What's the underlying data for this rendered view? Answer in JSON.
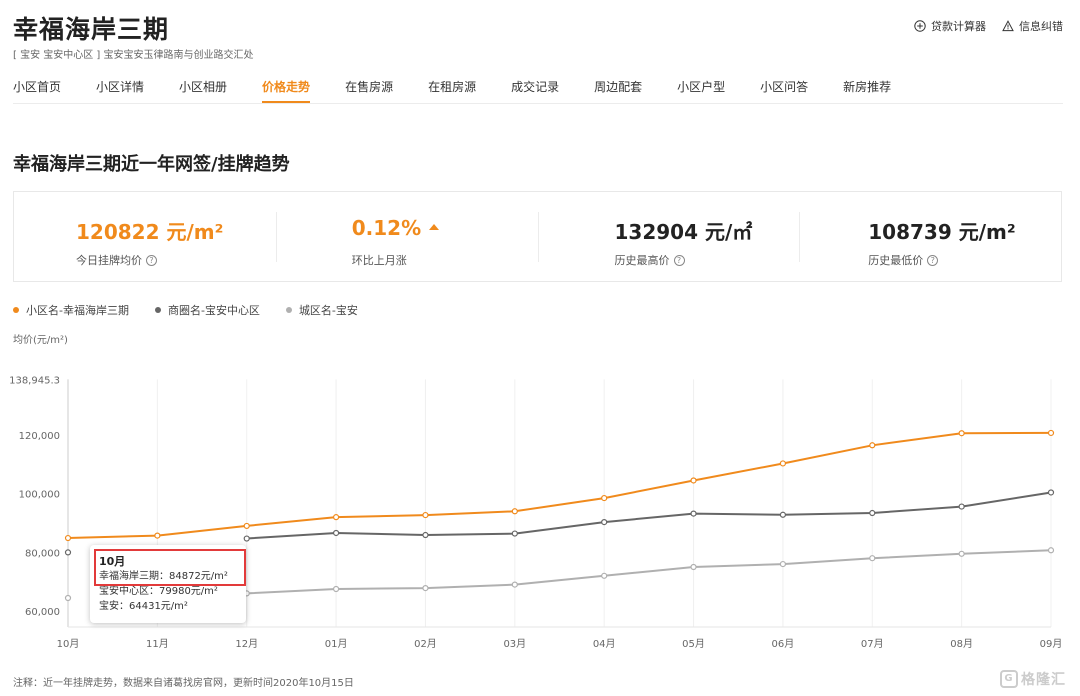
{
  "header": {
    "title": "幸福海岸三期",
    "address": "[ 宝安 宝安中心区 ] 宝安宝安玉律路南与创业路交汇处",
    "tools": [
      {
        "label": "贷款计算器",
        "icon": "plus-circle-icon"
      },
      {
        "label": "信息纠错",
        "icon": "warning-triangle-icon"
      }
    ]
  },
  "tabs": [
    {
      "label": "小区首页"
    },
    {
      "label": "小区详情"
    },
    {
      "label": "小区相册"
    },
    {
      "label": "价格走势",
      "active": true
    },
    {
      "label": "在售房源"
    },
    {
      "label": "在租房源"
    },
    {
      "label": "成交记录"
    },
    {
      "label": "周边配套"
    },
    {
      "label": "小区户型"
    },
    {
      "label": "小区问答"
    },
    {
      "label": "新房推荐"
    }
  ],
  "section": {
    "title": "幸福海岸三期近一年网签/挂牌趋势"
  },
  "stats": [
    {
      "value": "120822 元/m²",
      "label": "今日挂牌均价",
      "help": "?",
      "accent": "#f08a1c"
    },
    {
      "value": "0.12%",
      "label": "环比上月涨",
      "trend": "up-triangle-icon",
      "accent": "#f08a1c"
    },
    {
      "value": "132904 元/㎡",
      "label": "历史最高价",
      "help": "?"
    },
    {
      "value": "108739 元/m²",
      "label": "历史最低价",
      "help": "?"
    }
  ],
  "chart_data": {
    "type": "line",
    "ylabel": "均价(元/m²)",
    "ylim": [
      50000,
      138945.3
    ],
    "y_ticks": [
      "60,000",
      "80,000",
      "100,000",
      "120,000",
      "138,945.3"
    ],
    "y_tick_values": [
      60000,
      80000,
      100000,
      120000,
      138945.3
    ],
    "categories": [
      "10月",
      "11月",
      "12月",
      "01月",
      "02月",
      "03月",
      "04月",
      "05月",
      "06月",
      "07月",
      "08月",
      "09月"
    ],
    "grid": "vertical",
    "legend": "top-left",
    "series": [
      {
        "name": "小区名-幸福海岸三期",
        "color": "#f08a1c",
        "values": [
          84872,
          85700,
          89000,
          92000,
          92700,
          94000,
          98500,
          104500,
          110300,
          116500,
          120600,
          120700
        ]
      },
      {
        "name": "商圈名-宝安中心区",
        "color": "#666666",
        "values": [
          79980,
          null,
          84700,
          86600,
          85900,
          86400,
          90300,
          93200,
          92800,
          93400,
          95600,
          100400
        ]
      },
      {
        "name": "城区名-宝安",
        "color": "#b0b0b0",
        "values": [
          64431,
          null,
          66000,
          67500,
          67800,
          69000,
          72000,
          75000,
          76000,
          78000,
          79500,
          80700
        ]
      }
    ],
    "tooltip": {
      "title": "10月",
      "rows": [
        "幸福海岸三期：84872元/m²",
        "宝安中心区：79980元/m²",
        "宝安：64431元/m²"
      ]
    }
  },
  "footnote": "注释：近一年挂牌走势，数据来自诸葛找房官网，更新时间2020年10月15日",
  "watermark": {
    "text": "格隆汇",
    "mark": "G"
  }
}
